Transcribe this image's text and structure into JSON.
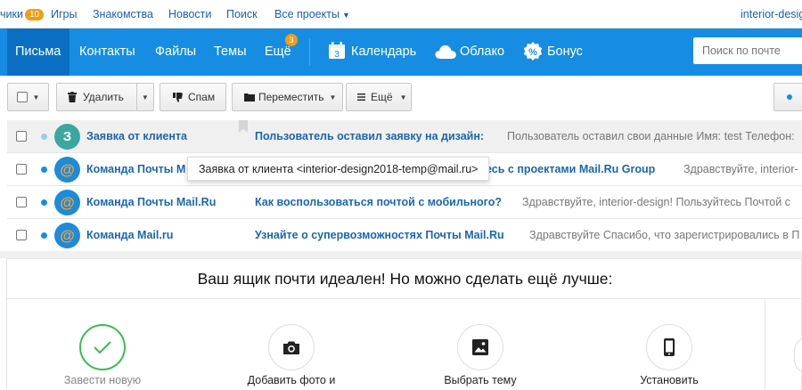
{
  "topbar": {
    "messages_label": "чики",
    "messages_count": "10",
    "games": "Игры",
    "dating": "Знакомства",
    "news": "Новости",
    "search": "Поиск",
    "all_projects": "Все проекты",
    "user": "interior-design"
  },
  "nav": {
    "letters": "Письма",
    "contacts": "Контакты",
    "files": "Файлы",
    "themes": "Темы",
    "more": "Ещё",
    "more_count": "3",
    "calendar": "Календарь",
    "calendar_day": "3",
    "cloud": "Облако",
    "bonus": "Бонус",
    "search_placeholder": "Поиск по почте",
    "active_color": "#0a6fc2",
    "bar_color": "#168de2"
  },
  "toolbar": {
    "delete": "Удалить",
    "spam": "Спам",
    "move": "Переместить",
    "more": "Ещё"
  },
  "messages": [
    {
      "sender": "Заявка от клиента",
      "avatar": "З",
      "subject": "Пользователь оставил заявку на дизайн:",
      "snippet": "Пользователь оставил свои данные Имя: test Телефон:"
    },
    {
      "sender": "Команда Почты M",
      "avatar": "@",
      "subject": "есь с проектами Mail.Ru Group",
      "snippet": "Здравствуйте, interior-"
    },
    {
      "sender": "Команда Почты Mail.Ru",
      "avatar": "@",
      "subject": "Как воспользоваться почтой с мобильного?",
      "snippet": "Здравствуйте, interior-design! Пользуйтесь Почтой с"
    },
    {
      "sender": "Команда Mail.ru",
      "avatar": "@",
      "subject": "Узнайте о супервозможностях Почты Mail.Ru",
      "snippet": "Здравствуйте Спасибо, что зарегистрировались в П"
    }
  ],
  "tooltip": "Заявка от клиента <interior-design2018-temp@mail.ru>",
  "promo": {
    "title": "Ваш ящик почти идеален! Но можно сделать ещё лучше:",
    "steps": [
      {
        "label": "Завести новую",
        "icon": "check-icon"
      },
      {
        "label": "Добавить фото и",
        "icon": "camera-icon"
      },
      {
        "label": "Выбрать тему",
        "icon": "image-icon"
      },
      {
        "label": "Установить",
        "icon": "phone-icon"
      }
    ]
  }
}
